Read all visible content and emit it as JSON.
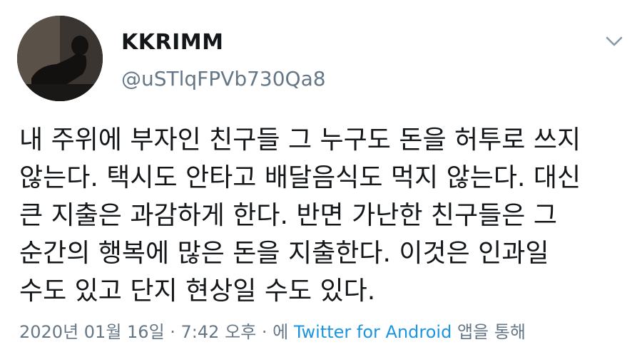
{
  "tweet": {
    "display_name": "KKRIMM",
    "handle": "@uSTlqFPVb730Qa8",
    "menu_icon": "chevron-down-icon",
    "text": "내 주위에 부자인 친구들 그 누구도 돈을 허투로 쓰지\n않는다. 택시도 안타고 배달음식도 먹지 않는다. 대신\n큰 지출은 과감하게 한다. 반면 가난한 친구들은 그\n순간의 행복에 많은 돈을 지출한다. 이것은 인과일\n수도 있고 단지 현상일 수도 있다.",
    "meta": {
      "timestamp": "2020년 01월 16일 · 7:42 오후 · 에",
      "source": "Twitter for Android",
      "suffix": "앱을 통해"
    }
  },
  "colors": {
    "text": "#14171a",
    "secondary": "#657786",
    "link": "#1b95e0"
  }
}
